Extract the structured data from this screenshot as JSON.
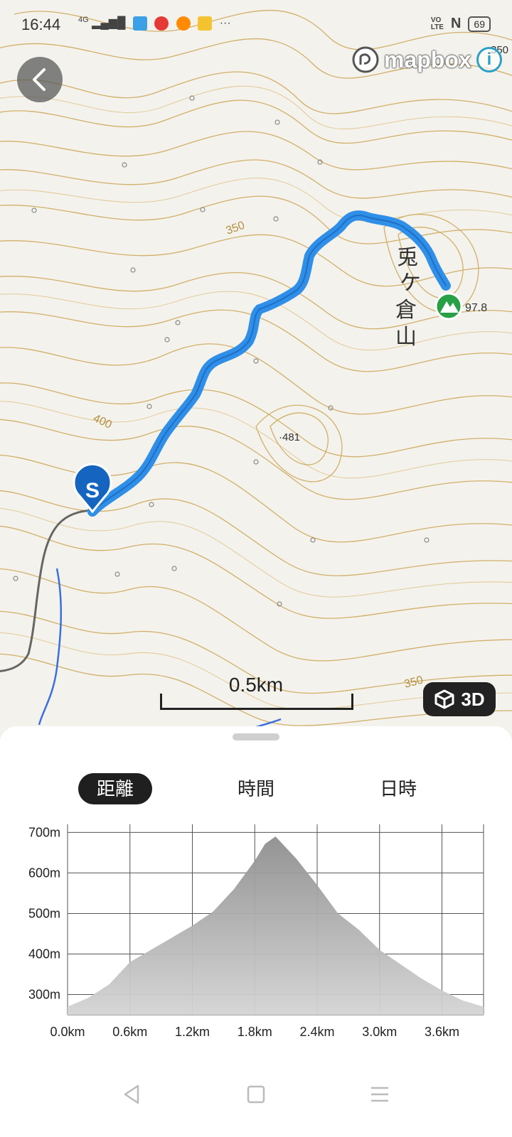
{
  "status": {
    "time": "16:44",
    "network": "4G",
    "notif_icons": [
      "app-icon",
      "app-icon",
      "app-icon",
      "app-icon"
    ],
    "more": "···",
    "volte_top": "VO",
    "volte_bottom": "LTE",
    "nfc": "N",
    "battery": "69"
  },
  "map": {
    "mapbox_label": "mapbox",
    "info_label": "i",
    "btn3d_label": "3D",
    "scale_label": "0.5km",
    "peak_label": "97.8",
    "mountain_name": [
      "兎",
      "ケ",
      "倉",
      "山"
    ],
    "spot_elev_label": "·481",
    "contour_labels": [
      "350",
      "400",
      "350",
      "350"
    ],
    "start_marker": "S",
    "route_color": "#2f8fe8",
    "start_marker_color": "#1565c0",
    "peak_marker_color": "#27a046",
    "contour_color": "#c8a04a"
  },
  "tabs": [
    {
      "label": "距離",
      "active": true
    },
    {
      "label": "時間",
      "active": false
    },
    {
      "label": "日時",
      "active": false
    }
  ],
  "chart_data": {
    "type": "area",
    "xlabel": "",
    "ylabel": "",
    "x_ticks": [
      "0.0km",
      "0.6km",
      "1.2km",
      "1.8km",
      "2.4km",
      "3.0km",
      "3.6km"
    ],
    "y_ticks": [
      "300m",
      "400m",
      "500m",
      "600m",
      "700m"
    ],
    "xlim": [
      0,
      4.0
    ],
    "ylim": [
      250,
      720
    ],
    "x": [
      0.0,
      0.2,
      0.4,
      0.6,
      0.8,
      1.0,
      1.2,
      1.4,
      1.6,
      1.8,
      1.9,
      2.0,
      2.2,
      2.4,
      2.6,
      2.8,
      3.0,
      3.2,
      3.4,
      3.6,
      3.8,
      4.0
    ],
    "y": [
      270,
      292,
      325,
      380,
      410,
      440,
      470,
      505,
      560,
      630,
      672,
      690,
      635,
      570,
      500,
      460,
      410,
      375,
      340,
      310,
      285,
      270
    ],
    "fill_color": "#b3b3b3"
  },
  "navbar": {
    "back": "back-nav-icon",
    "home": "home-nav-icon",
    "menu": "menu-nav-icon"
  }
}
